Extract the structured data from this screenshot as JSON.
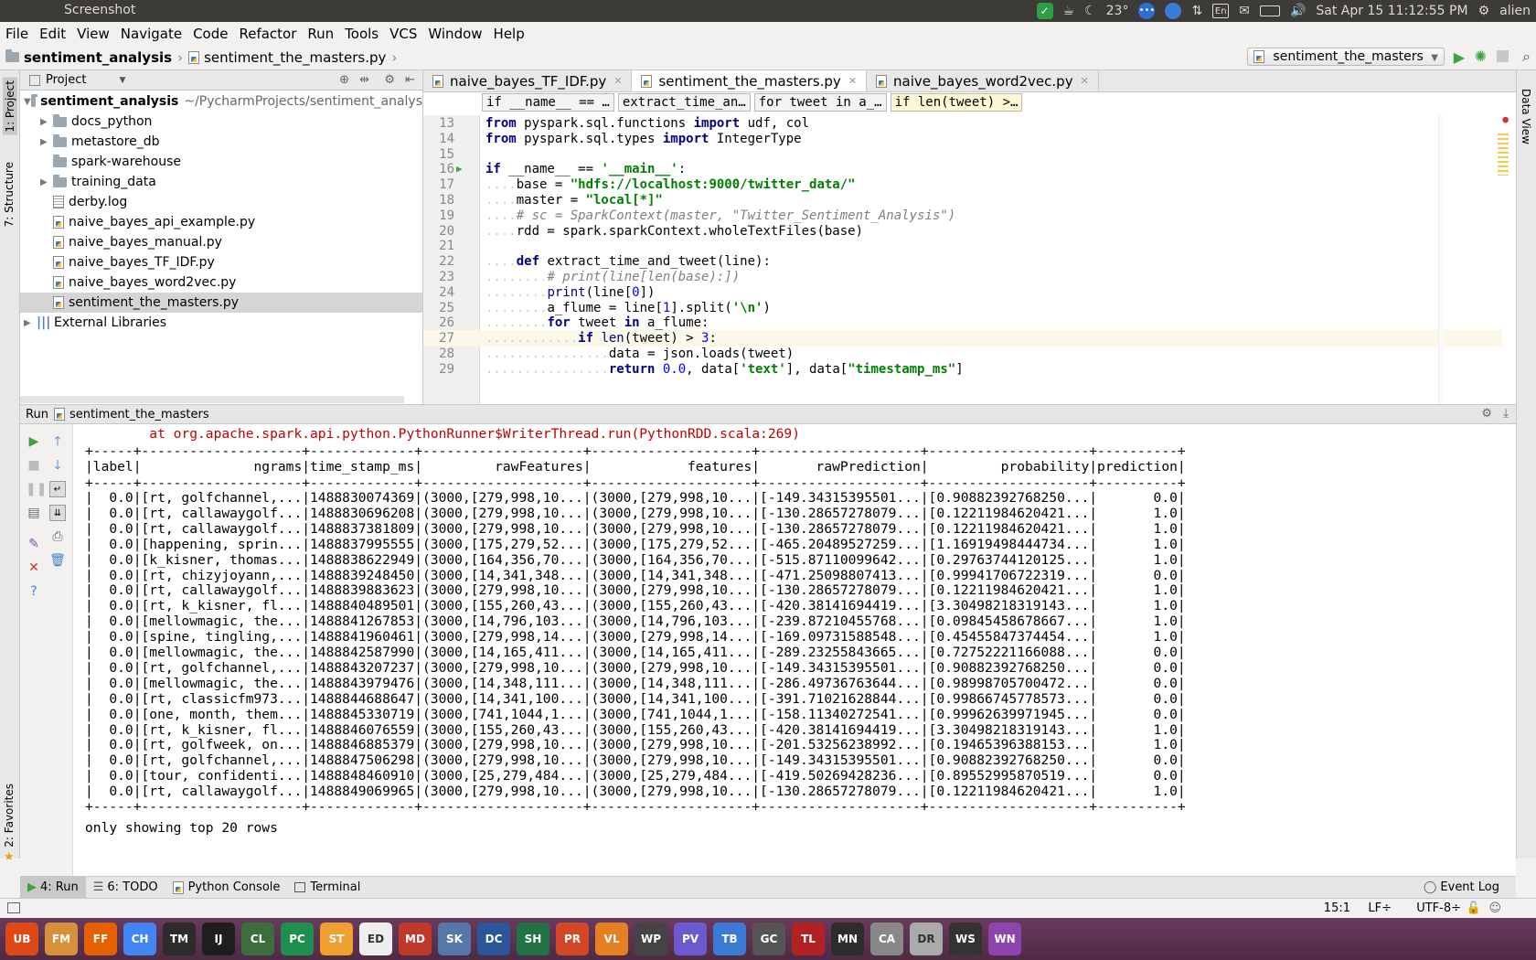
{
  "system": {
    "window_title": "Screenshot",
    "temperature": "23°",
    "lang": "En",
    "datetime": "Sat Apr 15 11:12:55 PM",
    "user": "alien"
  },
  "menu": [
    "File",
    "Edit",
    "View",
    "Navigate",
    "Code",
    "Refactor",
    "Run",
    "Tools",
    "VCS",
    "Window",
    "Help"
  ],
  "nav": {
    "project": "sentiment_analysis",
    "file": "sentiment_the_masters.py",
    "run_config": "sentiment_the_masters"
  },
  "left_strip": {
    "project": "1: Project",
    "structure": "7: Structure",
    "favorites": "2: Favorites"
  },
  "right_strip": {
    "data_view": "Data View"
  },
  "project_panel": {
    "title": "Project",
    "root": "sentiment_analysis",
    "root_path": "~/PycharmProjects/sentiment_analys",
    "items": [
      {
        "name": "docs_python",
        "type": "folder",
        "expandable": true
      },
      {
        "name": "metastore_db",
        "type": "folder",
        "expandable": true
      },
      {
        "name": "spark-warehouse",
        "type": "folder",
        "expandable": false
      },
      {
        "name": "training_data",
        "type": "folder",
        "expandable": true
      },
      {
        "name": "derby.log",
        "type": "text",
        "expandable": false
      },
      {
        "name": "naive_bayes_api_example.py",
        "type": "py",
        "expandable": false
      },
      {
        "name": "naive_bayes_manual.py",
        "type": "py",
        "expandable": false
      },
      {
        "name": "naive_bayes_TF_IDF.py",
        "type": "py",
        "expandable": false
      },
      {
        "name": "naive_bayes_word2vec.py",
        "type": "py",
        "expandable": false
      },
      {
        "name": "sentiment_the_masters.py",
        "type": "py",
        "expandable": false,
        "selected": true
      }
    ],
    "external": "External Libraries"
  },
  "editor": {
    "tabs": [
      {
        "label": "naive_bayes_TF_IDF.py",
        "active": false
      },
      {
        "label": "sentiment_the_masters.py",
        "active": true
      },
      {
        "label": "naive_bayes_word2vec.py",
        "active": false
      }
    ],
    "breadcrumbs": [
      "if __name__ == …",
      "extract_time_an…",
      "for tweet in a_…",
      "if len(tweet) >…"
    ],
    "lines": [
      {
        "n": "13",
        "html": "<span class='kw'>from</span> pyspark.sql.functions <span class='kw'>import</span> udf, col"
      },
      {
        "n": "14",
        "html": "<span class='kw'>from</span> pyspark.sql.types <span class='kw'>import</span> IntegerType"
      },
      {
        "n": "15",
        "html": ""
      },
      {
        "n": "16",
        "html": "<span class='kw'>if</span> __name__ == <span class='str'>'__main__'</span>:"
      },
      {
        "n": "17",
        "html": "<span class='dots'>....</span>base = <span class='str'>\"hdfs://localhost:9000/twitter_data/\"</span>"
      },
      {
        "n": "18",
        "html": "<span class='dots'>....</span>master = <span class='str'>\"local[*]\"</span>"
      },
      {
        "n": "19",
        "html": "<span class='dots'>....</span><span class='cm'># sc = SparkContext(master, \"Twitter_Sentiment_Analysis\")</span>"
      },
      {
        "n": "20",
        "html": "<span class='dots'>....</span>rdd = spark.sparkContext.wholeTextFiles(base)"
      },
      {
        "n": "21",
        "html": ""
      },
      {
        "n": "22",
        "html": "<span class='dots'>....</span><span class='kw'>def</span> extract_time_and_tweet(line):"
      },
      {
        "n": "23",
        "html": "<span class='dots'>........</span><span class='cm'># print(line[len(base):])</span>"
      },
      {
        "n": "24",
        "html": "<span class='dots'>........</span><span class='fn'>print</span>(line[<span class='numc'>0</span>])"
      },
      {
        "n": "25",
        "html": "<span class='dots'>........</span>a_flume = line[<span class='numc'>1</span>].split(<span class='str'>'\\n'</span>)"
      },
      {
        "n": "26",
        "html": "<span class='dots'>........</span><span class='kw'>for</span> tweet <span class='kw'>in</span> a_flume:"
      },
      {
        "n": "27",
        "html": "<span class='dots'>............</span><span class='kw'>if</span> <span class='fn'>len</span>(tweet) > <span class='numc'>3</span>:",
        "current": true
      },
      {
        "n": "28",
        "html": "<span class='dots'>................</span>data = json.loads(tweet)"
      },
      {
        "n": "29",
        "html": "<span class='dots'>................</span><span class='kw'>return</span> <span class='numc'>0.0</span>, data[<span class='str'>'text'</span>], data[<span class='str'>\"timestamp_ms\"</span>]"
      }
    ]
  },
  "run_panel": {
    "label": "Run",
    "config": "sentiment_the_masters",
    "lines": [
      {
        "cls": "err",
        "text": "\tat org.apache.spark.api.python.PythonRunner$WriterThread.run(PythonRDD.scala:269)"
      },
      {
        "cls": "",
        "text": "+-----+--------------------+-------------+--------------------+--------------------+--------------------+--------------------+----------+"
      },
      {
        "cls": "",
        "text": "|label|              ngrams|time_stamp_ms|         rawFeatures|            features|       rawPrediction|         probability|prediction|"
      },
      {
        "cls": "",
        "text": "+-----+--------------------+-------------+--------------------+--------------------+--------------------+--------------------+----------+"
      },
      {
        "cls": "",
        "text": "|  0.0|[rt, golfchannel,...|1488830074369|(3000,[279,998,10...|(3000,[279,998,10...|[-149.34315395501...|[0.90882392768250...|       0.0|"
      },
      {
        "cls": "",
        "text": "|  0.0|[rt, callawaygolf...|1488830696208|(3000,[279,998,10...|(3000,[279,998,10...|[-130.28657278079...|[0.12211984620421...|       1.0|"
      },
      {
        "cls": "",
        "text": "|  0.0|[rt, callawaygolf...|1488837381809|(3000,[279,998,10...|(3000,[279,998,10...|[-130.28657278079...|[0.12211984620421...|       1.0|"
      },
      {
        "cls": "",
        "text": "|  0.0|[happening, sprin...|1488837995555|(3000,[175,279,52...|(3000,[175,279,52...|[-465.20489527259...|[1.16919498444734...|       1.0|"
      },
      {
        "cls": "",
        "text": "|  0.0|[k_kisner, thomas...|1488838622949|(3000,[164,356,70...|(3000,[164,356,70...|[-515.87110099642...|[0.29763744120125...|       1.0|"
      },
      {
        "cls": "",
        "text": "|  0.0|[rt, chizyjoyann,...|1488839248450|(3000,[14,341,348...|(3000,[14,341,348...|[-471.25098807413...|[0.99941706722319...|       0.0|"
      },
      {
        "cls": "",
        "text": "|  0.0|[rt, callawaygolf...|1488839883623|(3000,[279,998,10...|(3000,[279,998,10...|[-130.28657278079...|[0.12211984620421...|       1.0|"
      },
      {
        "cls": "",
        "text": "|  0.0|[rt, k_kisner, fl...|1488840489501|(3000,[155,260,43...|(3000,[155,260,43...|[-420.38141694419...|[3.30498218319143...|       1.0|"
      },
      {
        "cls": "",
        "text": "|  0.0|[mellowmagic, the...|1488841267853|(3000,[14,796,103...|(3000,[14,796,103...|[-239.87210455768...|[0.09845458678667...|       1.0|"
      },
      {
        "cls": "",
        "text": "|  0.0|[spine, tingling,...|1488841960461|(3000,[279,998,14...|(3000,[279,998,14...|[-169.09731588548...|[0.45455847374454...|       1.0|"
      },
      {
        "cls": "",
        "text": "|  0.0|[mellowmagic, the...|1488842587990|(3000,[14,165,411...|(3000,[14,165,411...|[-289.23255843665...|[0.72752221166088...|       0.0|"
      },
      {
        "cls": "",
        "text": "|  0.0|[rt, golfchannel,...|1488843207237|(3000,[279,998,10...|(3000,[279,998,10...|[-149.34315395501...|[0.90882392768250...|       0.0|"
      },
      {
        "cls": "",
        "text": "|  0.0|[mellowmagic, the...|1488843979476|(3000,[14,348,111...|(3000,[14,348,111...|[-286.49736763644...|[0.98998705700472...|       0.0|"
      },
      {
        "cls": "",
        "text": "|  0.0|[rt, classicfm973...|1488844688647|(3000,[14,341,100...|(3000,[14,341,100...|[-391.71021628844...|[0.99866745778573...|       0.0|"
      },
      {
        "cls": "",
        "text": "|  0.0|[one, month, them...|1488845330719|(3000,[741,1044,1...|(3000,[741,1044,1...|[-158.11340272541...|[0.99962639971945...|       0.0|"
      },
      {
        "cls": "",
        "text": "|  0.0|[rt, k_kisner, fl...|1488846076559|(3000,[155,260,43...|(3000,[155,260,43...|[-420.38141694419...|[3.30498218319143...|       1.0|"
      },
      {
        "cls": "",
        "text": "|  0.0|[rt, golfweek, on...|1488846885379|(3000,[279,998,10...|(3000,[279,998,10...|[-201.53256238992...|[0.19465396388153...|       1.0|"
      },
      {
        "cls": "",
        "text": "|  0.0|[rt, golfchannel,...|1488847506298|(3000,[279,998,10...|(3000,[279,998,10...|[-149.34315395501...|[0.90882392768250...|       0.0|"
      },
      {
        "cls": "",
        "text": "|  0.0|[tour, confidenti...|1488848460910|(3000,[25,279,484...|(3000,[25,279,484...|[-419.50269428236...|[0.89552995870519...|       0.0|"
      },
      {
        "cls": "",
        "text": "|  0.0|[rt, callawaygolf...|1488849069965|(3000,[279,998,10...|(3000,[279,998,10...|[-130.28657278079...|[0.12211984620421...|       1.0|"
      },
      {
        "cls": "",
        "text": "+-----+--------------------+-------------+--------------------+--------------------+--------------------+--------------------+----------+"
      },
      {
        "cls": "",
        "text": "only showing top 20 rows"
      }
    ]
  },
  "bottom_tabs": [
    "4: Run",
    "6: TODO",
    "Python Console",
    "Terminal"
  ],
  "event_log": "Event Log",
  "status": {
    "position": "15:1",
    "line_sep": "LF÷",
    "encoding": "UTF-8÷"
  },
  "launcher": [
    "UB",
    "FM",
    "FF",
    "CH",
    "TM",
    "IJ",
    "CL",
    "PC",
    "ST",
    "ED",
    "MD",
    "SK",
    "DC",
    "SH",
    "PR",
    "VL",
    "WP",
    "PV",
    "TB",
    "GC",
    "TL",
    "MN",
    "CA",
    "DR",
    "WS",
    "WN"
  ]
}
